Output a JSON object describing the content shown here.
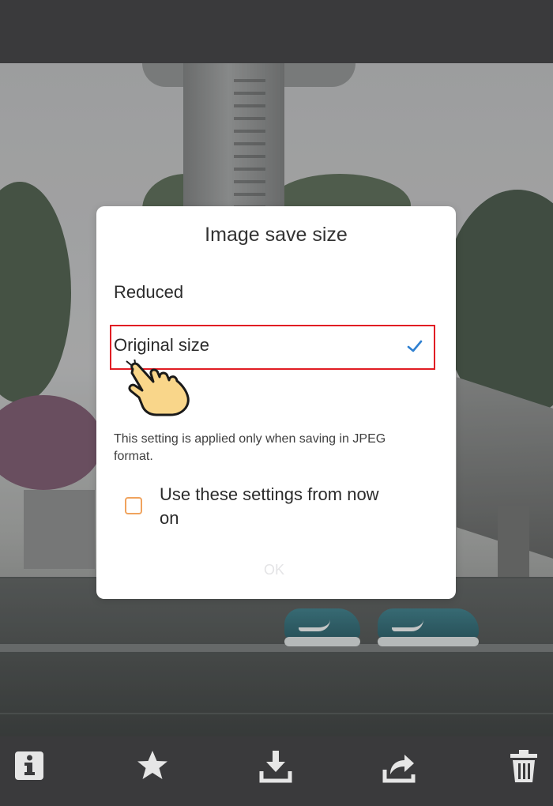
{
  "dialog": {
    "title": "Image save size",
    "options": [
      {
        "label": "Reduced",
        "selected": false
      },
      {
        "label": "Original size",
        "selected": true
      }
    ],
    "note": "This setting is applied only when saving in JPEG format.",
    "checkbox_label": "Use these settings from now on",
    "checkbox_checked": false,
    "ok_label": "OK"
  },
  "colors": {
    "highlight": "#e11d24",
    "check": "#2f80d1",
    "checkbox_border": "#f0a35e",
    "toolbar": "#3a3a3c"
  },
  "toolbar": {
    "buttons": [
      {
        "icon": "info-icon"
      },
      {
        "icon": "star-icon"
      },
      {
        "icon": "download-icon"
      },
      {
        "icon": "share-icon"
      },
      {
        "icon": "trash-icon"
      }
    ]
  }
}
